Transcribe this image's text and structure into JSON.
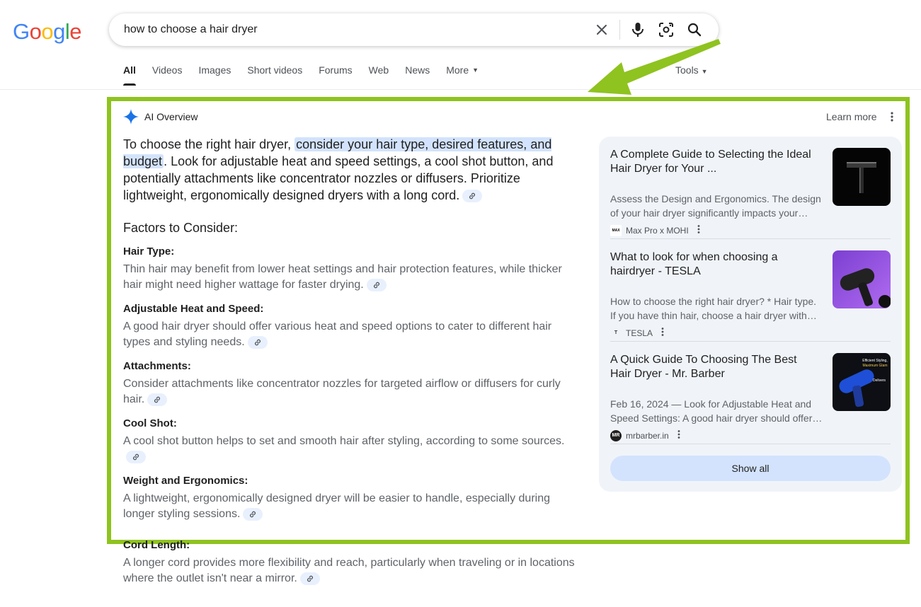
{
  "logo": {
    "letters": [
      "G",
      "o",
      "o",
      "g",
      "l",
      "e"
    ],
    "colors": [
      "#4285f4",
      "#ea4335",
      "#fbbc05",
      "#4285f4",
      "#34a853",
      "#ea4335"
    ]
  },
  "search": {
    "value": "how to choose a hair dryer"
  },
  "tabs": [
    {
      "label": "All",
      "active": true
    },
    {
      "label": "Videos"
    },
    {
      "label": "Images"
    },
    {
      "label": "Short videos"
    },
    {
      "label": "Forums"
    },
    {
      "label": "Web"
    },
    {
      "label": "News"
    },
    {
      "label": "More",
      "has_caret": true
    }
  ],
  "tools_label": "Tools",
  "ai_overview": {
    "title": "AI Overview",
    "learn_more": "Learn more",
    "lead_pre": "To choose the right hair dryer, ",
    "lead_highlight": "consider your hair type, desired features, and budget",
    "lead_post": ". Look for adjustable heat and speed settings, a cool shot button, and potentially attachments like concentrator nozzles or diffusers. Prioritize lightweight, ergonomically designed dryers with a long cord.",
    "section_title": "Factors to Consider:",
    "factors": [
      {
        "name": "Hair Type:",
        "text": "Thin hair may benefit from lower heat settings and hair protection features, while thicker hair might need higher wattage for faster drying."
      },
      {
        "name": "Adjustable Heat and Speed:",
        "text": "A good hair dryer should offer various heat and speed options to cater to different hair types and styling needs."
      },
      {
        "name": "Attachments:",
        "text": "Consider attachments like concentrator nozzles for targeted airflow or diffusers for curly hair."
      },
      {
        "name": "Cool Shot:",
        "text": "A cool shot button helps to set and smooth hair after styling, according to some sources."
      },
      {
        "name": "Weight and Ergonomics:",
        "text": "A lightweight, ergonomically designed dryer will be easier to handle, especially during longer styling sessions."
      },
      {
        "name": "Cord Length:",
        "text": "A longer cord provides more flexibility and reach, particularly when traveling or in locations where the outlet isn't near a mirror."
      }
    ]
  },
  "sources": [
    {
      "title": "A Complete Guide to Selecting the Ideal Hair Dryer for Your ...",
      "snippet": "Assess the Design and Ergonomics. The design of your hair dryer significantly impacts your overall styling experience.",
      "site": "Max Pro x MOHI",
      "favicon": "MAX"
    },
    {
      "title": "What to look for when choosing a hairdryer - TESLA",
      "snippet": "How to choose the right hair dryer? * Hair type. If you have thin hair, choose a hair dryer with lower power.",
      "site": "TESLA",
      "favicon": "T"
    },
    {
      "title": "A Quick Guide To Choosing The Best Hair Dryer - Mr. Barber",
      "snippet": "Feb 16, 2024 — Look for Adjustable Heat and Speed Settings: A good hair dryer should offer multiple heat settings.",
      "site": "mrbarber.in",
      "favicon": "MR"
    }
  ],
  "thumb3_text": {
    "line1": "Efficient Styling,",
    "line2": "Maximum Glam",
    "line3": "Delivers"
  },
  "show_all": "Show all",
  "colors": {
    "highlight_border": "#8fc31f",
    "accent_blue": "#1a73e8",
    "panel_bg": "#f0f4f9",
    "mark_bg": "#d3e3fd"
  }
}
